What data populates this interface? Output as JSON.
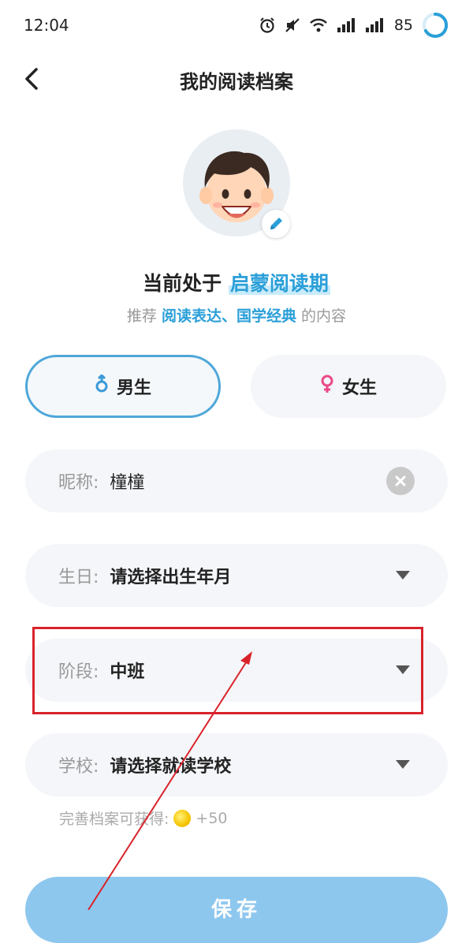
{
  "status_bar": {
    "time": "12:04",
    "battery": "85"
  },
  "header": {
    "title": "我的阅读档案"
  },
  "profile": {
    "stage_prefix": "当前处于",
    "stage_name": "启蒙阅读期",
    "recommend_prefix": "推荐",
    "recommend_topics": "阅读表达、国学经典",
    "recommend_suffix": "的内容"
  },
  "gender": {
    "male_label": "男生",
    "female_label": "女生",
    "selected": "male"
  },
  "form": {
    "nickname": {
      "label": "昵称:",
      "value": "橦橦"
    },
    "birthday": {
      "label": "生日:",
      "value": "请选择出生年月"
    },
    "stage": {
      "label": "阶段:",
      "value": "中班"
    },
    "school": {
      "label": "学校:",
      "value": "请选择就读学校"
    }
  },
  "reward": {
    "text": "完善档案可获得:",
    "value": "+50"
  },
  "save_button": {
    "label": "保存"
  },
  "colors": {
    "accent": "#2b9fd8",
    "highlight_box": "#d9232b",
    "save_bg": "#8ec7ee"
  }
}
